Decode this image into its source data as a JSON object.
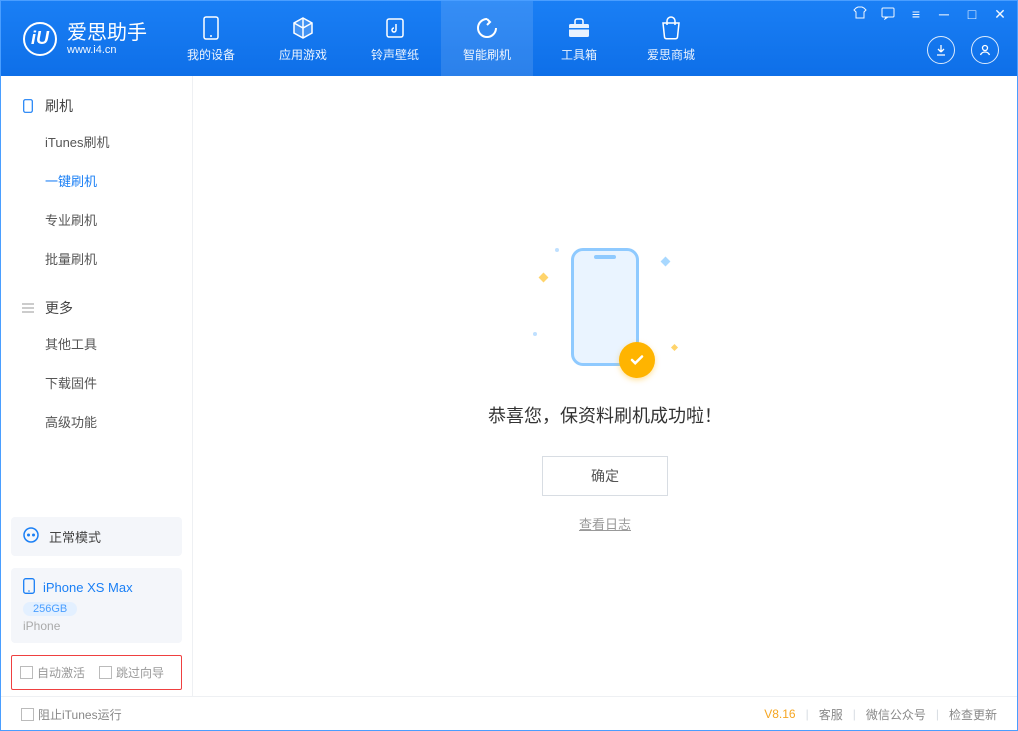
{
  "brand": {
    "name": "爱思助手",
    "url": "www.i4.cn"
  },
  "nav": [
    {
      "id": "device",
      "label": "我的设备"
    },
    {
      "id": "apps",
      "label": "应用游戏"
    },
    {
      "id": "ring",
      "label": "铃声壁纸"
    },
    {
      "id": "flash",
      "label": "智能刷机"
    },
    {
      "id": "tools",
      "label": "工具箱"
    },
    {
      "id": "store",
      "label": "爱思商城"
    }
  ],
  "sidebar": {
    "sec1": {
      "title": "刷机",
      "items": [
        "iTunes刷机",
        "一键刷机",
        "专业刷机",
        "批量刷机"
      ]
    },
    "sec2": {
      "title": "更多",
      "items": [
        "其他工具",
        "下载固件",
        "高级功能"
      ]
    },
    "mode": "正常模式",
    "device": {
      "name": "iPhone XS Max",
      "capacity": "256GB",
      "type": "iPhone"
    },
    "checks": {
      "autoActivate": "自动激活",
      "skipGuide": "跳过向导"
    }
  },
  "main": {
    "successMsg": "恭喜您，保资料刷机成功啦！",
    "okBtn": "确定",
    "logLink": "查看日志"
  },
  "footer": {
    "blockItunes": "阻止iTunes运行",
    "version": "V8.16",
    "links": [
      "客服",
      "微信公众号",
      "检查更新"
    ]
  }
}
